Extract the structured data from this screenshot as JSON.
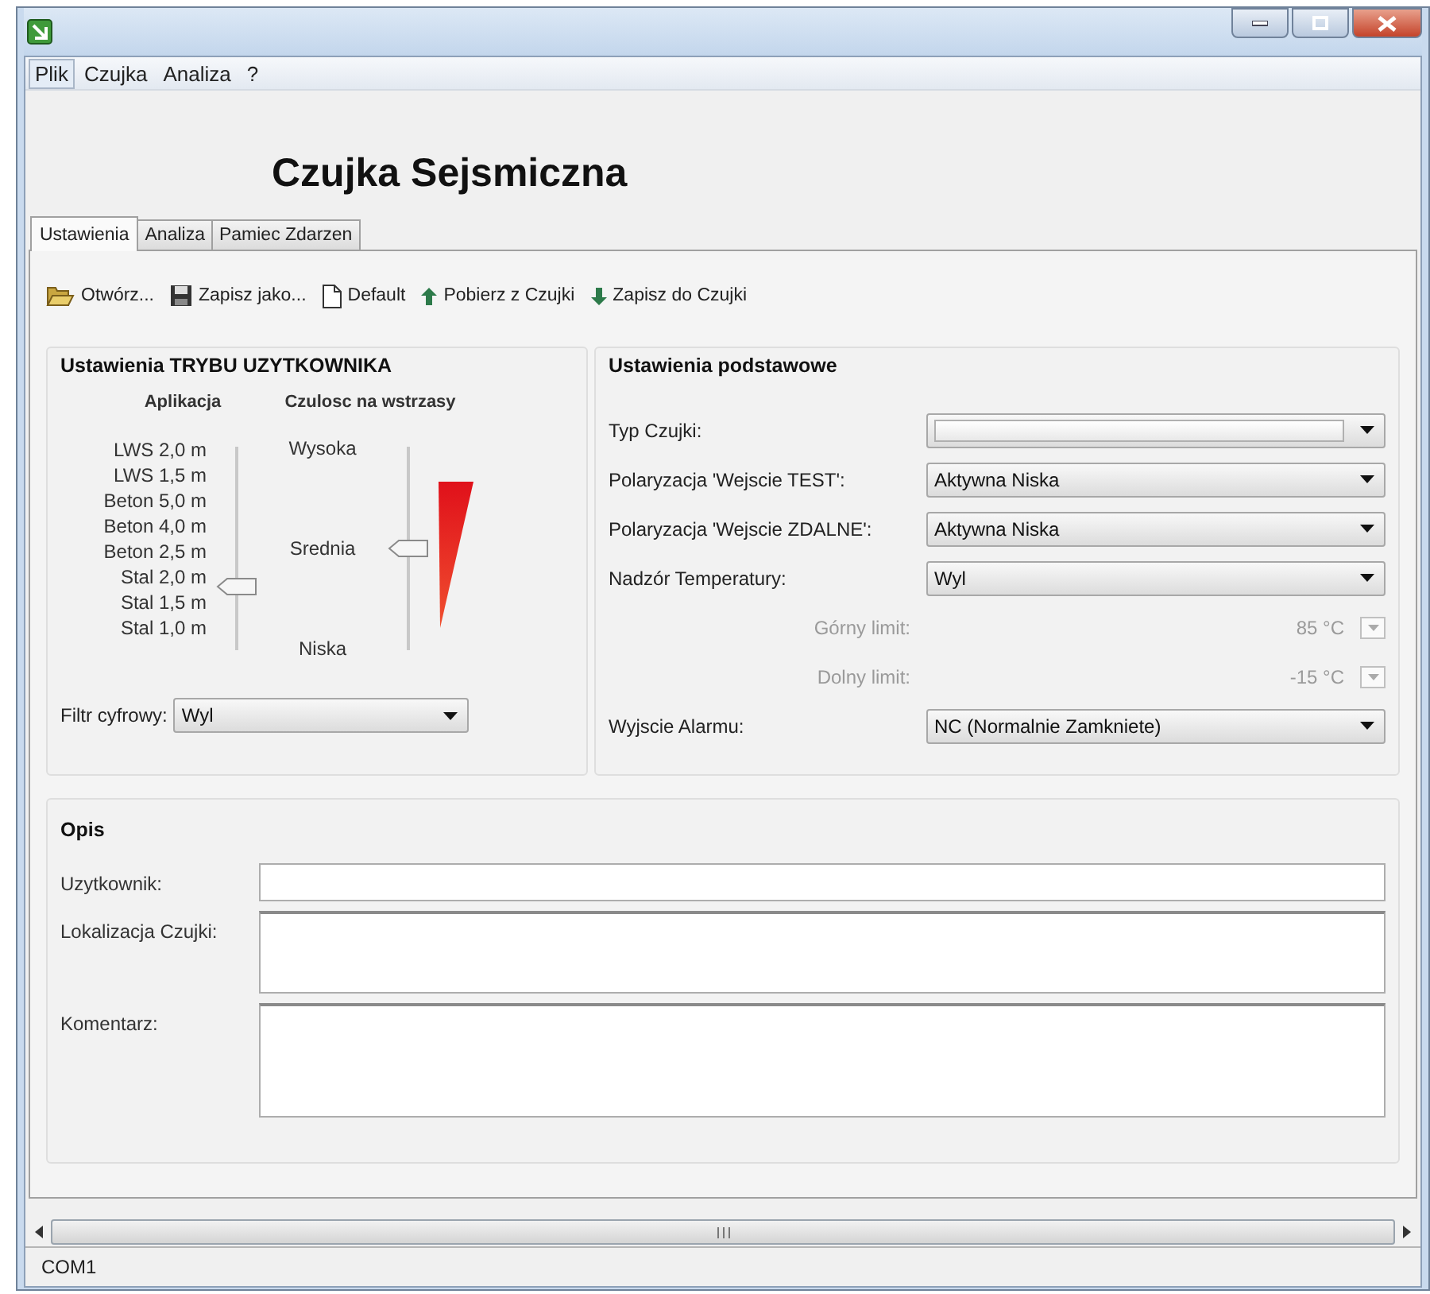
{
  "menu": [
    {
      "label": "Plik",
      "selected": true
    },
    {
      "label": "Czujka",
      "selected": false
    },
    {
      "label": "Analiza",
      "selected": false
    },
    {
      "label": "?",
      "selected": false
    }
  ],
  "app_title": "Czujka Sejsmiczna",
  "tabs": [
    {
      "label": "Ustawienia",
      "selected": true
    },
    {
      "label": "Analiza",
      "selected": false
    },
    {
      "label": "Pamiec Zdarzen",
      "selected": false
    }
  ],
  "toolbar": [
    {
      "kind": "folder",
      "label": "Otwórz..."
    },
    {
      "kind": "floppy",
      "label": "Zapisz jako..."
    },
    {
      "kind": "page",
      "label": "Default"
    },
    {
      "kind": "up",
      "label": "Pobierz z Czujki"
    },
    {
      "kind": "down",
      "label": "Zapisz do Czujki"
    }
  ],
  "user_mode": {
    "title": "Ustawienia TRYBU UZYTKOWNIKA",
    "application": {
      "heading": "Aplikacja",
      "options": [
        "LWS 2,0 m",
        "LWS 1,5 m",
        "Beton 5,0 m",
        "Beton 4,0 m",
        "Beton 2,5 m",
        "Stal 2,0 m",
        "Stal 1,5 m",
        "Stal 1,0 m"
      ],
      "level": 0.29
    },
    "sensitivity": {
      "heading": "Czulosc na wstrzasy",
      "options": [
        "Wysoka",
        "Srednia",
        "Niska"
      ],
      "level": 0.5
    },
    "filter": {
      "label": "Filtr cyfrowy:",
      "value": "Wyl"
    }
  },
  "basic": {
    "title": "Ustawienia podstawowe",
    "fields": [
      {
        "kind": "combo",
        "label": "Typ Czujki:",
        "disabled": false
      },
      {
        "kind": "combo",
        "label": "Polaryzacja 'Wejscie TEST':",
        "value": "Aktywna Niska",
        "disabled": false
      },
      {
        "kind": "combo",
        "label": "Polaryzacja 'Wejscie ZDALNE':",
        "value": "Aktywna Niska",
        "disabled": false
      },
      {
        "kind": "combo",
        "label": "Nadzór Temperatury:",
        "value": "Wyl",
        "disabled": false
      },
      {
        "kind": "spin",
        "label": "Górny limit:",
        "value": "85 °C",
        "disabled": true
      },
      {
        "kind": "spin",
        "label": "Dolny limit:",
        "value": "-15 °C",
        "disabled": true
      },
      {
        "kind": "combo",
        "label": "Wyjscie Alarmu:",
        "value": "NC (Normalnie Zamkniete)",
        "disabled": false
      }
    ]
  },
  "description": {
    "title": "Opis",
    "fields": [
      {
        "kind": "line",
        "label": "Uzytkownik:"
      },
      {
        "kind": "area",
        "label": "Lokalizacja Czujki:"
      },
      {
        "kind": "tall_area",
        "label": "Komentarz:"
      }
    ]
  },
  "status_bar": "COM1"
}
